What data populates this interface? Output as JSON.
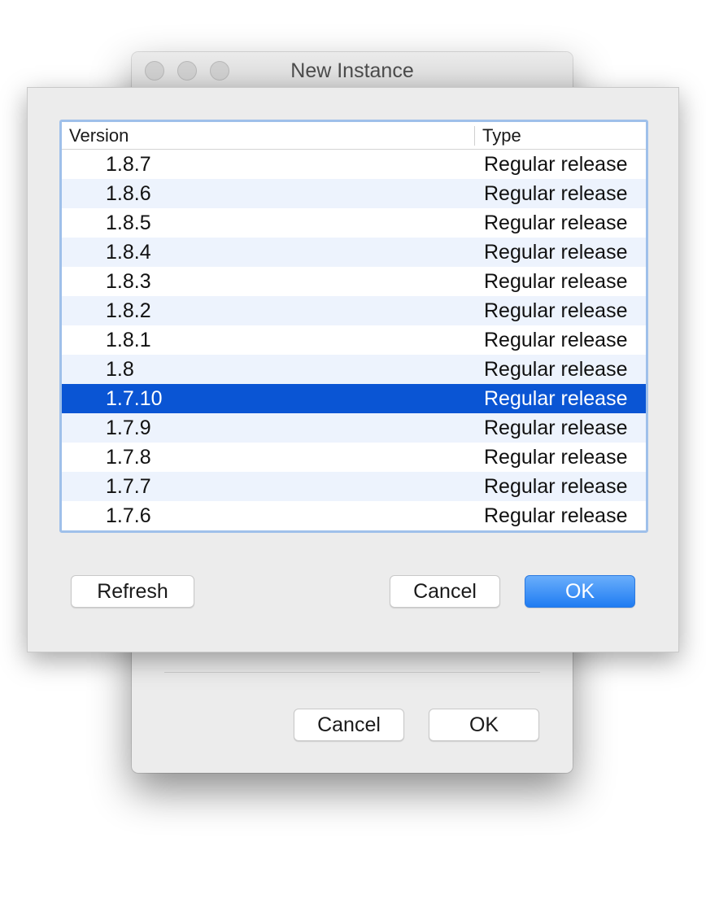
{
  "window": {
    "title": "New Instance"
  },
  "background_dialog": {
    "cancel_label": "Cancel",
    "ok_label": "OK"
  },
  "table": {
    "columns": [
      "Version",
      "Type"
    ],
    "selected_index": 8,
    "rows": [
      {
        "version": "1.8.7",
        "type": "Regular release"
      },
      {
        "version": "1.8.6",
        "type": "Regular release"
      },
      {
        "version": "1.8.5",
        "type": "Regular release"
      },
      {
        "version": "1.8.4",
        "type": "Regular release"
      },
      {
        "version": "1.8.3",
        "type": "Regular release"
      },
      {
        "version": "1.8.2",
        "type": "Regular release"
      },
      {
        "version": "1.8.1",
        "type": "Regular release"
      },
      {
        "version": "1.8",
        "type": "Regular release"
      },
      {
        "version": "1.7.10",
        "type": "Regular release"
      },
      {
        "version": "1.7.9",
        "type": "Regular release"
      },
      {
        "version": "1.7.8",
        "type": "Regular release"
      },
      {
        "version": "1.7.7",
        "type": "Regular release"
      },
      {
        "version": "1.7.6",
        "type": "Regular release"
      }
    ]
  },
  "sheet_buttons": {
    "refresh_label": "Refresh",
    "cancel_label": "Cancel",
    "ok_label": "OK"
  },
  "colors": {
    "selection": "#0a55d4",
    "alternate_row": "#edf3fd",
    "default_button": "#1f7cf2",
    "focus_ring": "#9fc0ea"
  }
}
